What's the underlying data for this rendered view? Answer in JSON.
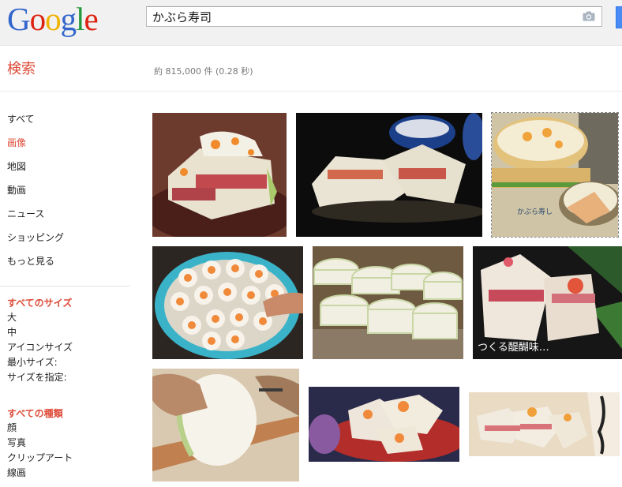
{
  "logo": {
    "letters": [
      {
        "ch": "G",
        "color": "#3366cc"
      },
      {
        "ch": "o",
        "color": "#dd2211"
      },
      {
        "ch": "o",
        "color": "#f2b200"
      },
      {
        "ch": "g",
        "color": "#3366cc"
      },
      {
        "ch": "l",
        "color": "#22993a"
      },
      {
        "ch": "e",
        "color": "#dd2211"
      }
    ]
  },
  "search": {
    "query": "かぶら寿司"
  },
  "page": {
    "title": "検索",
    "stats": "約 815,000 件 (0.28 秒)"
  },
  "nav": {
    "items": [
      {
        "label": "すべて",
        "active": false
      },
      {
        "label": "画像",
        "active": true
      },
      {
        "label": "地図",
        "active": false
      },
      {
        "label": "動画",
        "active": false
      },
      {
        "label": "ニュース",
        "active": false
      },
      {
        "label": "ショッピング",
        "active": false
      },
      {
        "label": "もっと見る",
        "active": false
      }
    ]
  },
  "filters": {
    "size": {
      "heading": "すべてのサイズ",
      "options": [
        "大",
        "中",
        "アイコンサイズ",
        "最小サイズ:",
        "サイズを指定:"
      ]
    },
    "type": {
      "heading": "すべての種類",
      "options": [
        "顔",
        "写真",
        "クリップアート",
        "線画"
      ]
    }
  },
  "images": {
    "overlay_caption": "つくる醍醐味…",
    "calligraphy": "かぶら寿し"
  },
  "colors": {
    "accent": "#dd4b39",
    "link": "#222222",
    "button": "#4a8af4"
  }
}
